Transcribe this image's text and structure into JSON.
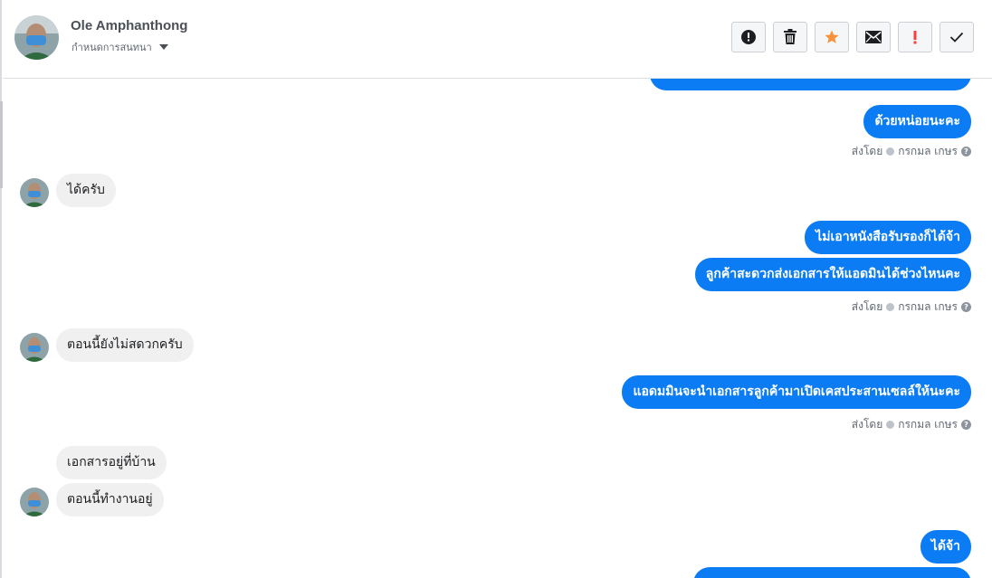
{
  "header": {
    "contact_name": "Ole Amphanthong",
    "conversation_menu_label": "กำหนดการสนทนา",
    "actions": [
      {
        "name": "report-spam",
        "icon": "exclamation-circle-icon"
      },
      {
        "name": "delete",
        "icon": "trash-icon"
      },
      {
        "name": "star",
        "icon": "star-icon",
        "color": "#f7923a"
      },
      {
        "name": "mark-unread",
        "icon": "envelope-icon"
      },
      {
        "name": "important",
        "icon": "exclamation-icon",
        "color": "#fa3e3e"
      },
      {
        "name": "mark-done",
        "icon": "checkmark-icon"
      }
    ]
  },
  "messages": {
    "out_1": "ด้วยหน่อยนะคะ",
    "sent_by_1": "ส่งโดย",
    "sender_1": "กรกมล เกษร",
    "in_1": "ได้ครับ",
    "out_2": "ไม่เอาหนังสือรับรองก็ได้จ้า",
    "out_3": "ลูกค้าสะดวกส่งเอกสารให้แอดมินได้ช่วงไหนคะ",
    "sent_by_2": "ส่งโดย",
    "sender_2": "กรกมล เกษร",
    "in_2": "ตอนนี้ยังไม่สดวกครับ",
    "out_4": "แอดมมินจะนำเอกสารลูกค้ามาเปิดเคสประสานเซลล์ให้นะคะ",
    "sent_by_3": "ส่งโดย",
    "sender_3": "กรกมล เกษร",
    "in_3": "เอกสารอยู่ที่บ้าน",
    "in_4": "ตอนนี้ทำงานอยู่",
    "out_5": "ได้จ้า"
  },
  "colors": {
    "outgoing_bubble": "#0b7cf3",
    "incoming_bubble": "#f1f0f0"
  }
}
